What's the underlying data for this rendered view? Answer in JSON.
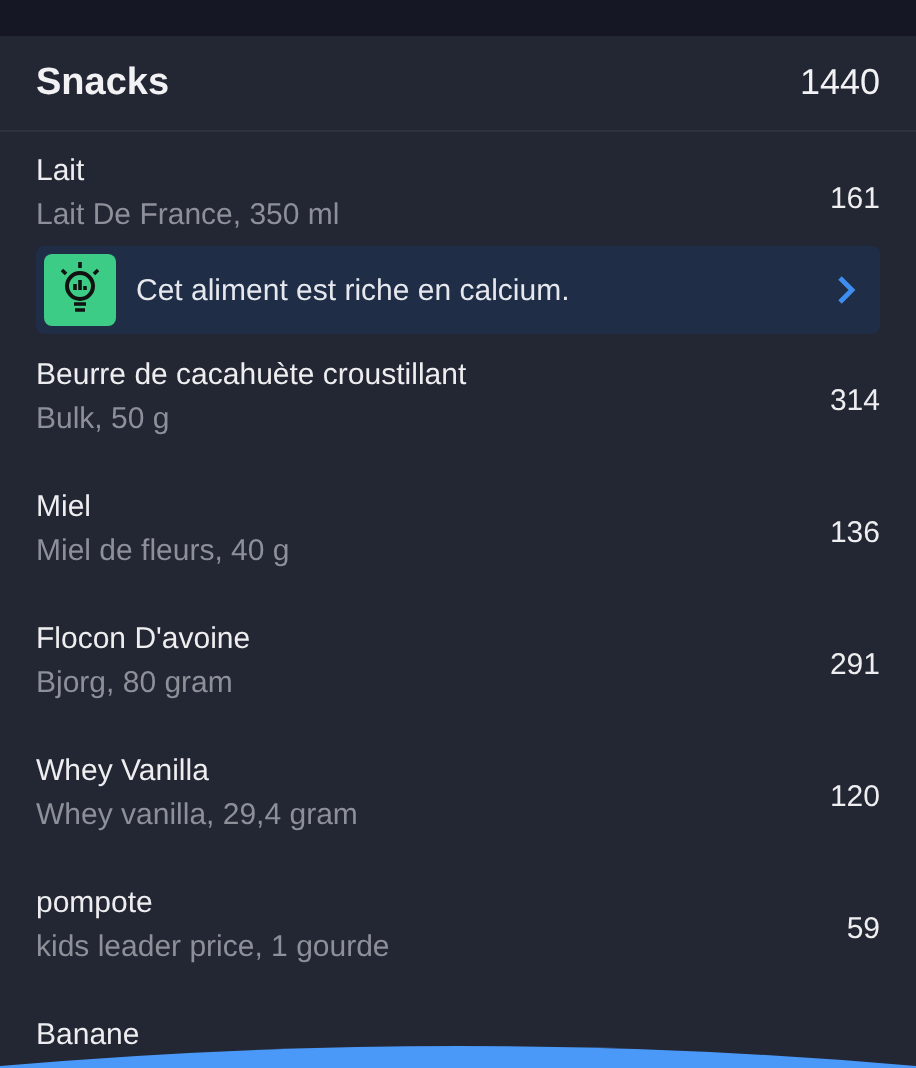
{
  "section": {
    "title": "Snacks",
    "total": "1440"
  },
  "items": [
    {
      "name": "Lait",
      "detail": "Lait De France, 350 ml",
      "calories": "161",
      "tip": {
        "text": "Cet aliment est riche en calcium."
      }
    },
    {
      "name": "Beurre de cacahuète croustillant",
      "detail": "Bulk, 50 g",
      "calories": "314"
    },
    {
      "name": "Miel",
      "detail": "Miel de fleurs, 40 g",
      "calories": "136"
    },
    {
      "name": "Flocon D'avoine",
      "detail": "Bjorg, 80 gram",
      "calories": "291"
    },
    {
      "name": "Whey Vanilla",
      "detail": "Whey vanilla, 29,4 gram",
      "calories": "120"
    },
    {
      "name": "pompote",
      "detail": "kids leader price, 1 gourde",
      "calories": "59"
    },
    {
      "name": "Banane"
    }
  ]
}
